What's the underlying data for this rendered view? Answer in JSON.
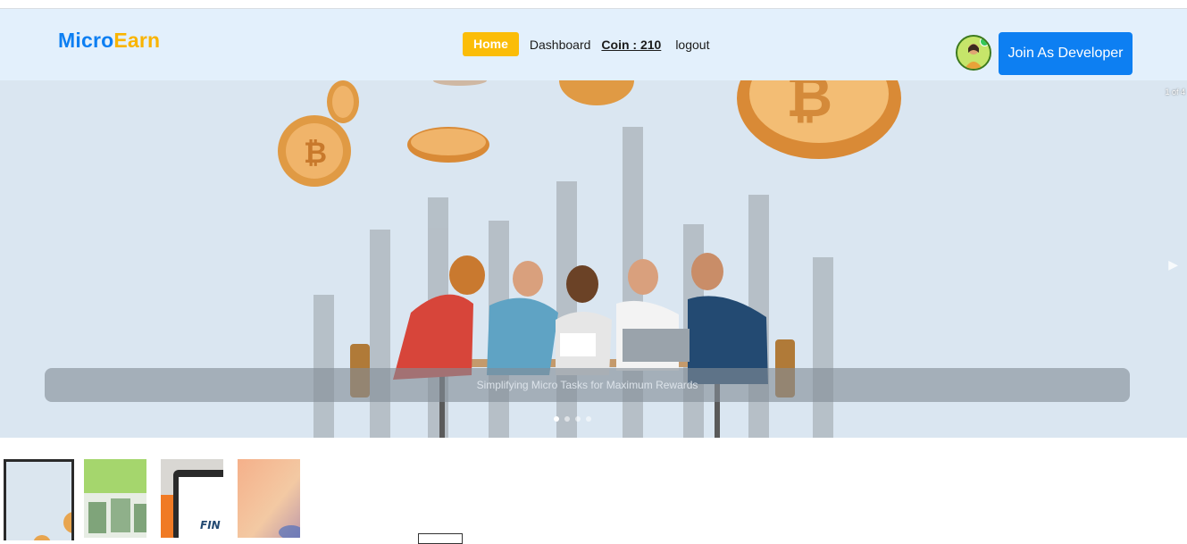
{
  "brand": {
    "part1": "Micro",
    "part2": "Earn"
  },
  "nav": {
    "home": "Home",
    "dashboard": "Dashboard",
    "coin": "Coin : 210",
    "logout": "logout"
  },
  "actions": {
    "join_developer": "Join As Developer"
  },
  "carousel": {
    "counter": "1 of 4",
    "caption": "Simplifying Micro Tasks for Maximum Rewards",
    "slide_count": 4,
    "active_slide": 1
  },
  "colors": {
    "brand_blue": "#0d7ff2",
    "brand_yellow": "#f9b400",
    "nav_bg": "#e3f0fc",
    "home_button": "#fbbd08"
  }
}
